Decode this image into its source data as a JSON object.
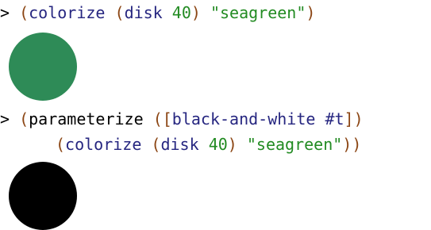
{
  "prompt": ">",
  "expr1": {
    "open": "(",
    "fn": "colorize",
    "inner_open": "(",
    "inner_fn": "disk",
    "size": "40",
    "inner_close": ")",
    "color_arg": "\"seagreen\"",
    "close": ")"
  },
  "result1": {
    "fill": "#2e8b57"
  },
  "expr2": {
    "open": "(",
    "fn": "parameterize",
    "params_open": "([",
    "param_name": "black-and-white",
    "param_value": "#t",
    "params_close": "])",
    "body_open": "(",
    "body_fn": "colorize",
    "body_inner_open": "(",
    "body_inner_fn": "disk",
    "body_size": "40",
    "body_inner_close": ")",
    "body_color_arg": "\"seagreen\"",
    "close": "))"
  },
  "result2": {
    "fill": "#000000"
  }
}
